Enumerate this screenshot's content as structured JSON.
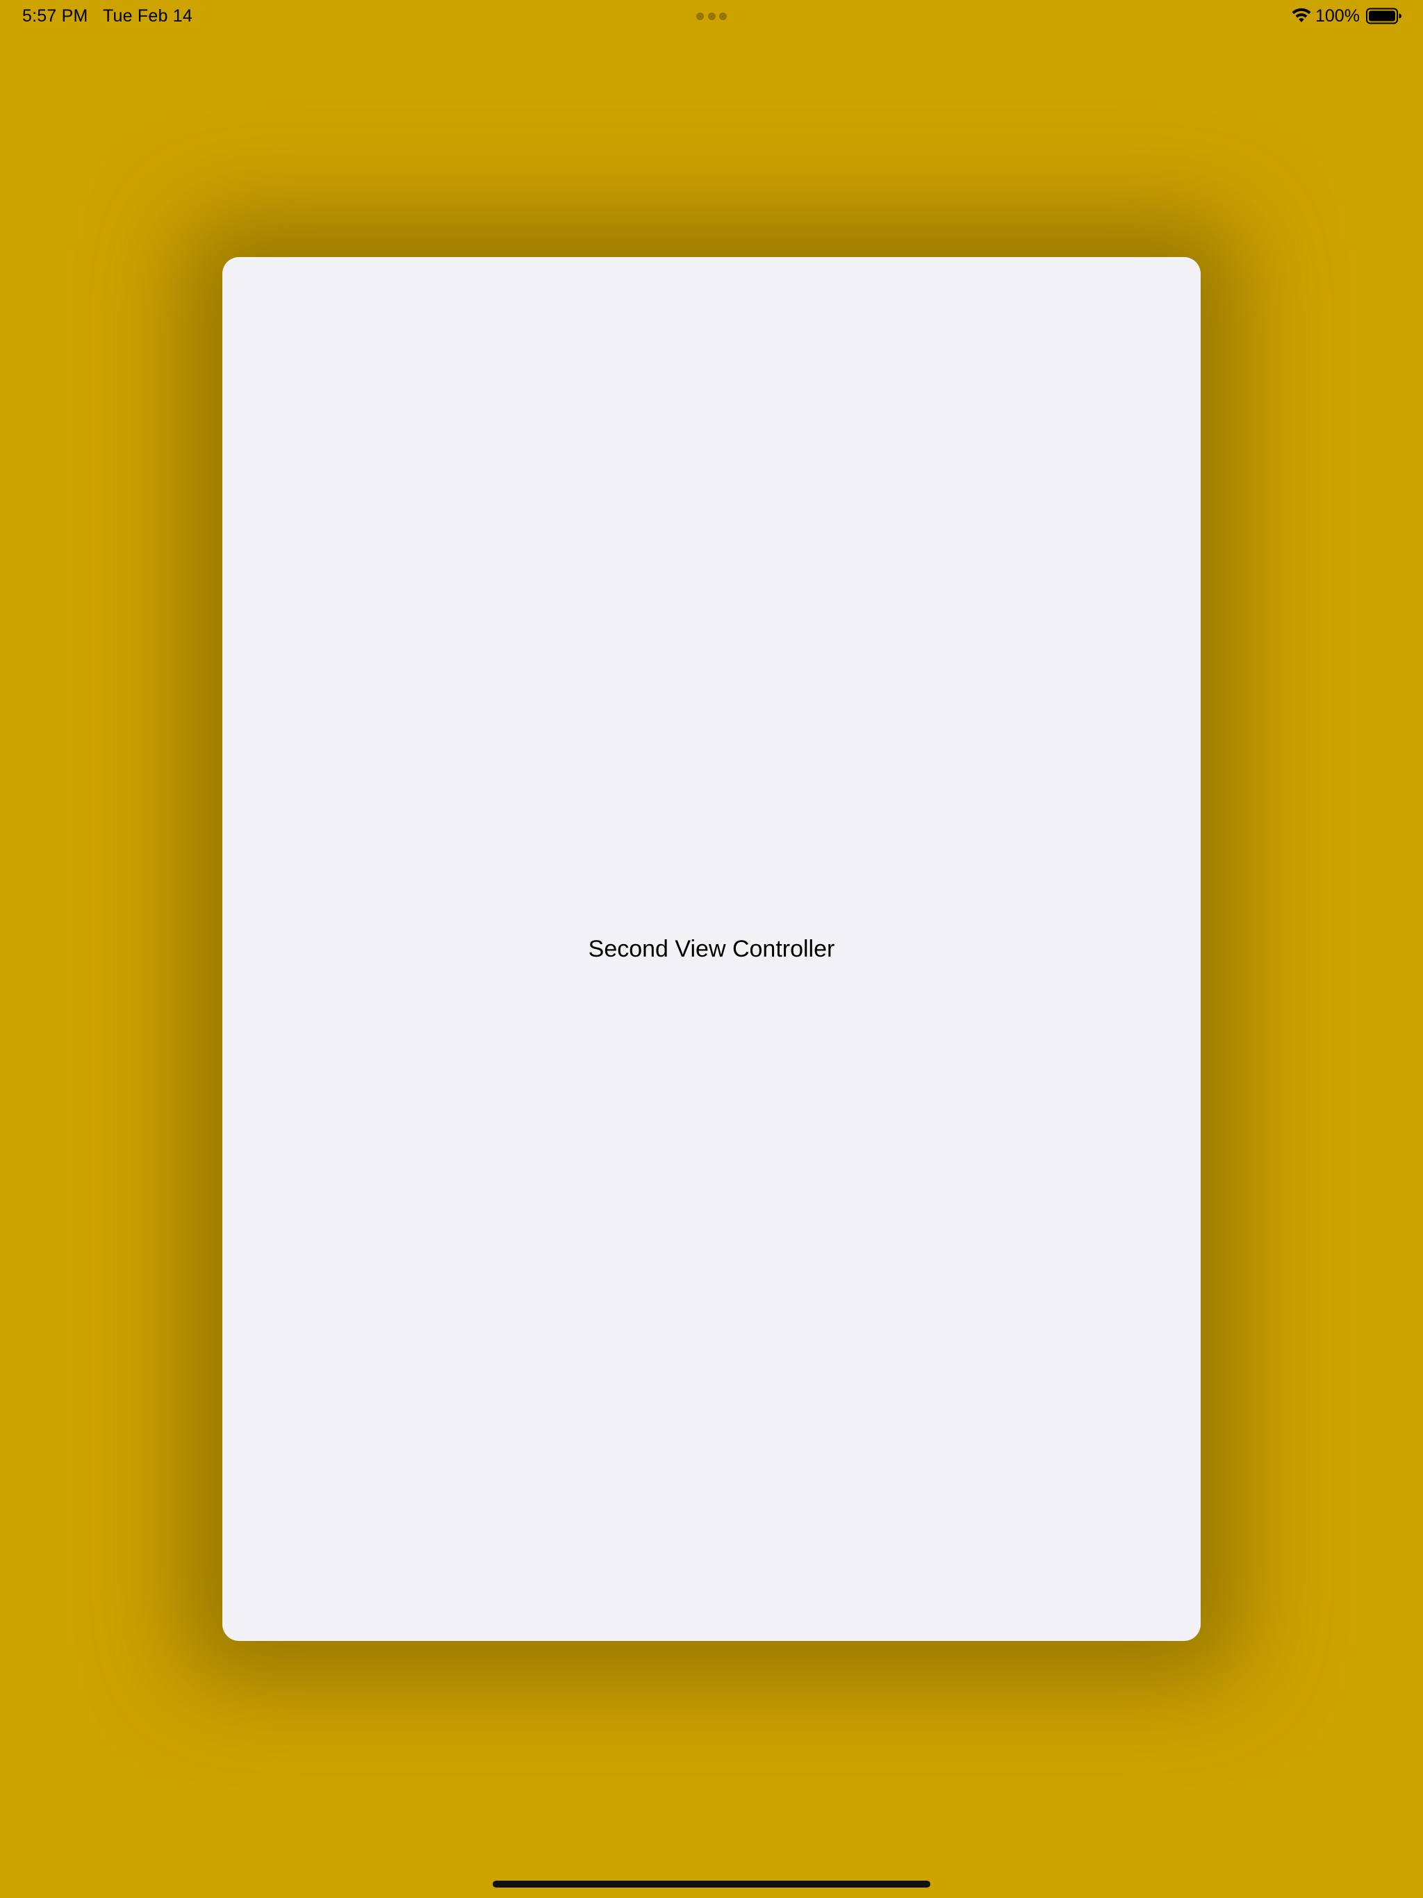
{
  "status_bar": {
    "time": "5:57 PM",
    "date": "Tue Feb 14",
    "battery_percent": "100%",
    "icons": [
      "multitask-dots-icon",
      "wifi-icon",
      "battery-icon"
    ]
  },
  "modal": {
    "title": "Second View Controller"
  },
  "colors": {
    "background": "#cda300",
    "sheet": "#f2f2f7",
    "text": "#000000"
  }
}
